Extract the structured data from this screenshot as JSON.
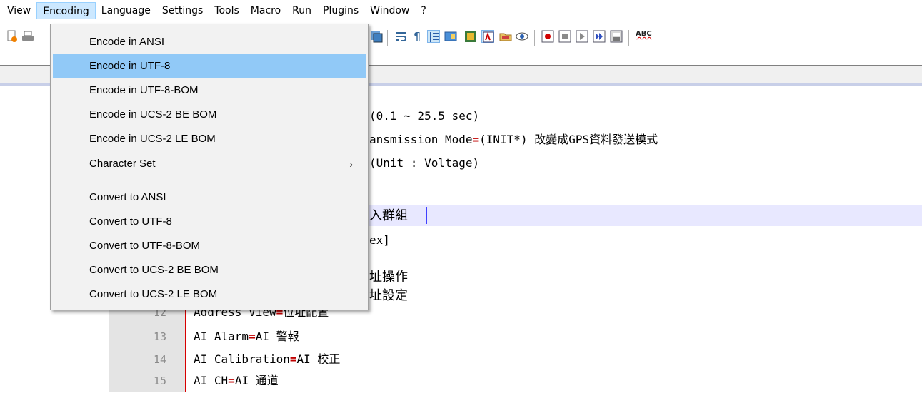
{
  "menubar": {
    "items": [
      "View",
      "Encoding",
      "Language",
      "Settings",
      "Tools",
      "Macro",
      "Run",
      "Plugins",
      "Window",
      "?"
    ],
    "active_index": 1
  },
  "encoding_menu": {
    "items": [
      {
        "label": "Encode in ANSI"
      },
      {
        "label": "Encode in UTF-8",
        "highlighted": true
      },
      {
        "label": "Encode in UTF-8-BOM"
      },
      {
        "label": "Encode in UCS-2 BE BOM"
      },
      {
        "label": "Encode in UCS-2 LE BOM"
      },
      {
        "label": "Character Set",
        "submenu_arrow": "›"
      },
      {
        "label": "Convert to ANSI"
      },
      {
        "label": "Convert to UTF-8"
      },
      {
        "label": "Convert to UTF-8-BOM"
      },
      {
        "label": "Convert to UCS-2 BE BOM"
      },
      {
        "label": "Convert to UCS-2 LE BOM"
      }
    ]
  },
  "toolbar": {
    "icons": [
      "new-file-icon",
      "print-icon",
      "save-all-icon",
      "word-wrap-icon",
      "show-all-characters-icon",
      "indent-guide-icon",
      "document-map-icon",
      "function-list-icon",
      "folder-as-workspace-icon",
      "monitoring-icon",
      "record-macro-icon",
      "stop-record-icon",
      "playback-macro-icon",
      "run-macro-multiple-icon",
      "save-macro-icon",
      "spell-check-icon"
    ],
    "spell_check_label": "ABC",
    "pilcrow": "¶"
  },
  "editor": {
    "visible_fragments": [
      {
        "text": "(0.1 ~ 25.5 sec)"
      },
      {
        "pre": "ansmission Mode",
        "op": "=",
        "post": "(INIT*) 改變成GPS資料發送模式"
      },
      {
        "text": "(Unit : Voltage)"
      },
      {
        "text": "入群組"
      },
      {
        "text": "ex]"
      },
      {
        "text": "址操作"
      },
      {
        "text": "址設定"
      }
    ],
    "lines": [
      {
        "num": "12",
        "pre": "Address View",
        "op": "=",
        "post": "位址配置"
      },
      {
        "num": "13",
        "pre": "AI Alarm",
        "op": "=",
        "post": "AI 警報"
      },
      {
        "num": "14",
        "pre": "AI Calibration",
        "op": "=",
        "post": "AI 校正"
      },
      {
        "num": "15",
        "pre": "AI CH",
        "op": "=",
        "post": "AI 通道"
      }
    ]
  },
  "colors": {
    "highlight": "#91c9f7",
    "menu_active": "#cce8ff",
    "operator": "#c00000",
    "margin_line": "#d80000"
  }
}
